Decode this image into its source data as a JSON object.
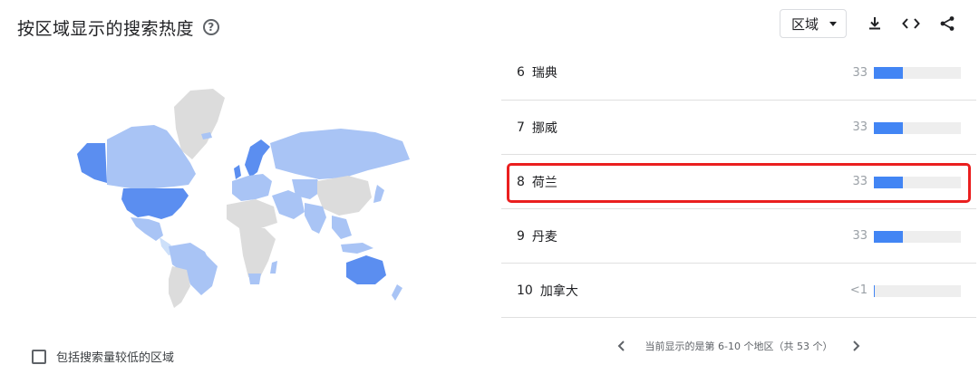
{
  "header": {
    "title": "按区域显示的搜索热度",
    "help_icon": "help-circle-icon"
  },
  "toolbar": {
    "region_select": {
      "value": "区域"
    },
    "icons": [
      "download-icon",
      "embed-code-icon",
      "share-icon"
    ]
  },
  "map": {
    "icon": "world-choropleth-map",
    "colors": {
      "high": "#5b8ef0",
      "medium": "#a9c4f5",
      "low": "#cde0fa",
      "none": "#dcdcdc"
    }
  },
  "filter": {
    "checkbox_label": "包括搜索量较低的区域",
    "checked": false
  },
  "regions": [
    {
      "rank": "6",
      "name": "瑞典",
      "value": "33",
      "level": 0.33
    },
    {
      "rank": "7",
      "name": "挪威",
      "value": "33",
      "level": 0.33
    },
    {
      "rank": "8",
      "name": "荷兰",
      "value": "33",
      "level": 0.33,
      "highlighted": true
    },
    {
      "rank": "9",
      "name": "丹麦",
      "value": "33",
      "level": 0.33
    },
    {
      "rank": "10",
      "name": "加拿大",
      "value": "<1",
      "level": 0.005
    }
  ],
  "pagination": {
    "text": "当前显示的是第 6-10 个地区（共 53 个）"
  },
  "colors": {
    "bar_fill": "#4285f4",
    "bar_track": "#eeeeee",
    "highlight": "#ea1f1f"
  }
}
